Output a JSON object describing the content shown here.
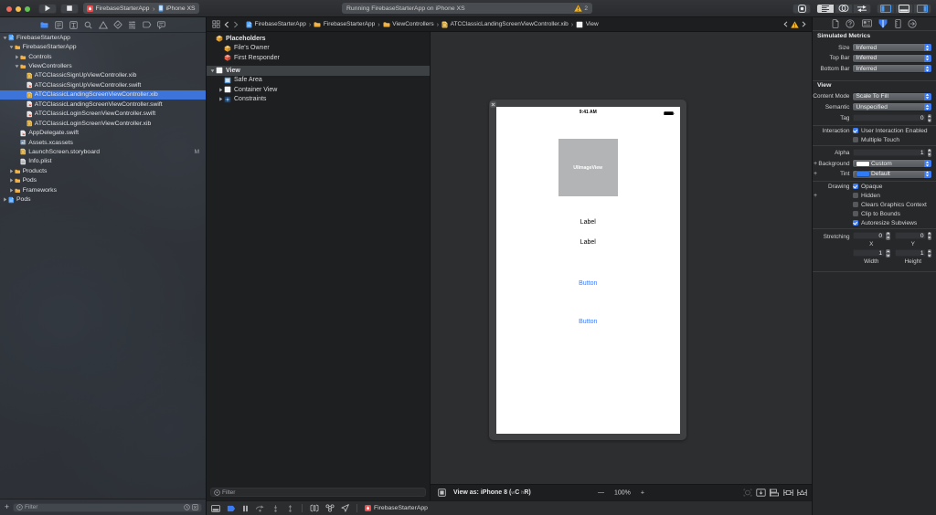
{
  "colors": {
    "accent_blue": "#3b7cf6",
    "selection_blue": "#3c74d9",
    "folder_amber": "#efaa3a",
    "warning_yellow": "#f6b21b",
    "run_red": "#ec5f5f"
  },
  "toolbar": {
    "play_button": "play",
    "stop_button": "stop",
    "scheme": {
      "app_name": "FirebaseStarterApp",
      "separator": "›",
      "device_name": "iPhone XS"
    },
    "status": {
      "message": "Running FirebaseStarterApp on iPhone XS",
      "warning_count": "2"
    }
  },
  "navigator": {
    "tabs": [
      "project",
      "source-control",
      "symbol",
      "find",
      "issue",
      "test",
      "debug",
      "breakpoint",
      "report"
    ],
    "selected_tab": "project",
    "tree": [
      {
        "label": "FirebaseStarterApp",
        "icon": "project",
        "level": 0,
        "disc": "open"
      },
      {
        "label": "FirebaseStarterApp",
        "icon": "folder",
        "level": 1,
        "disc": "open"
      },
      {
        "label": "Controls",
        "icon": "folder",
        "level": 2,
        "disc": "closed"
      },
      {
        "label": "ViewControllers",
        "icon": "folder",
        "level": 2,
        "disc": "open"
      },
      {
        "label": "ATCClassicSignUpViewController.xib",
        "icon": "xib",
        "level": 3
      },
      {
        "label": "ATCClassicSignUpViewController.swift",
        "icon": "swift",
        "level": 3
      },
      {
        "label": "ATCClassicLandingScreenViewController.xib",
        "icon": "xib",
        "level": 3,
        "selected": true
      },
      {
        "label": "ATCClassicLandingScreenViewController.swift",
        "icon": "swift",
        "level": 3
      },
      {
        "label": "ATCClassicLoginScreenViewController.swift",
        "icon": "swift",
        "level": 3
      },
      {
        "label": "ATCClassicLoginScreenViewController.xib",
        "icon": "xib",
        "level": 3
      },
      {
        "label": "AppDelegate.swift",
        "icon": "swift",
        "level": 2
      },
      {
        "label": "Assets.xcassets",
        "icon": "xcassets",
        "level": 2
      },
      {
        "label": "LaunchScreen.storyboard",
        "icon": "storyboard",
        "level": 2,
        "badge": "M"
      },
      {
        "label": "Info.plist",
        "icon": "plist",
        "level": 2
      },
      {
        "label": "Products",
        "icon": "folder",
        "level": 1,
        "disc": "closed"
      },
      {
        "label": "Pods",
        "icon": "folder",
        "level": 1,
        "disc": "closed"
      },
      {
        "label": "Frameworks",
        "icon": "folder",
        "level": 1,
        "disc": "closed"
      },
      {
        "label": "Pods",
        "icon": "project",
        "level": 0,
        "disc": "closed"
      }
    ],
    "filter": {
      "placeholder": "Filter"
    }
  },
  "jumpbar": {
    "crumbs": [
      {
        "label": "FirebaseStarterApp",
        "icon": "project"
      },
      {
        "label": "FirebaseStarterApp",
        "icon": "folder"
      },
      {
        "label": "ViewControllers",
        "icon": "folder"
      },
      {
        "label": "ATCClassicLandingScreenViewController.xib",
        "icon": "xib"
      },
      {
        "label": "View",
        "icon": "view-square"
      }
    ],
    "separator": "›"
  },
  "outline": {
    "rows": [
      {
        "label": "Placeholders",
        "icon": "cube-amber",
        "level": 0,
        "head": true
      },
      {
        "label": "File's Owner",
        "icon": "cube-amber",
        "level": 1
      },
      {
        "label": "First Responder",
        "icon": "cube-red",
        "level": 1
      },
      {
        "label": "View",
        "icon": "view-square",
        "level": 0,
        "head": true,
        "disc": "open",
        "selected": true,
        "gap_before": true
      },
      {
        "label": "Safe Area",
        "icon": "safe-area",
        "level": 1
      },
      {
        "label": "Container View",
        "icon": "view-square",
        "level": 1,
        "disc": "closed"
      },
      {
        "label": "Constraints",
        "icon": "constraints",
        "level": 1,
        "disc": "closed"
      }
    ],
    "filter": {
      "placeholder": "Filter"
    }
  },
  "canvas": {
    "device": {
      "status_time": "9:41 AM",
      "imageview_label": "UIImageView",
      "labels": [
        "Label",
        "Label"
      ],
      "buttons": [
        "Button",
        "Button"
      ]
    },
    "bar": {
      "view_as_prefix": "View as: iPhone 8 (",
      "trait_w": "w",
      "trait_wc": "C",
      "trait_h": "h",
      "trait_hr": "R)",
      "zoom_out": "—",
      "zoom_level": "100%",
      "zoom_in": "+"
    }
  },
  "debugbar": {
    "icons": [
      "toggle-debug-area",
      "breakpoints",
      "pause",
      "step-over",
      "step-into",
      "step-out",
      "view-hierarchy",
      "memory-graph",
      "simulate-location"
    ],
    "process_name": "FirebaseStarterApp"
  },
  "inspector": {
    "tabs": [
      "file",
      "quick-help",
      "identity",
      "attributes",
      "size",
      "connections"
    ],
    "selected_tab": "attributes",
    "sections": [
      {
        "header": "Simulated Metrics",
        "rows": [
          {
            "type": "popup",
            "label": "Size",
            "value": "Inferred"
          },
          {
            "type": "popup",
            "label": "Top Bar",
            "value": "Inferred"
          },
          {
            "type": "popup",
            "label": "Bottom Bar",
            "value": "Inferred"
          }
        ]
      },
      {
        "header": "View",
        "rows": [
          {
            "type": "popup",
            "label": "Content Mode",
            "value": "Scale To Fill"
          },
          {
            "type": "popup",
            "label": "Semantic",
            "value": "Unspecified"
          },
          {
            "type": "field",
            "label": "Tag",
            "value": "0"
          },
          {
            "type": "sep"
          },
          {
            "type": "check",
            "label": "Interaction",
            "value": "User Interaction Enabled",
            "checked": true
          },
          {
            "type": "check",
            "label": "",
            "value": "Multiple Touch",
            "checked": false
          },
          {
            "type": "sep"
          },
          {
            "type": "field",
            "label": "Alpha",
            "value": "1"
          },
          {
            "type": "popup",
            "label": "Background",
            "value": "Custom",
            "swatch": "#ffffff",
            "plus": true
          },
          {
            "type": "popup",
            "label": "Tint",
            "value": "Default",
            "swatch": "#2f7cf6",
            "plus": true
          },
          {
            "type": "sep"
          },
          {
            "type": "check",
            "label": "Drawing",
            "value": "Opaque",
            "checked": true
          },
          {
            "type": "check",
            "label": "",
            "value": "Hidden",
            "checked": false,
            "plus": true
          },
          {
            "type": "check",
            "label": "",
            "value": "Clears Graphics Context",
            "checked": false
          },
          {
            "type": "check",
            "label": "",
            "value": "Clip to Bounds",
            "checked": false
          },
          {
            "type": "check",
            "label": "",
            "value": "Autoresize Subviews",
            "checked": true
          },
          {
            "type": "sep"
          },
          {
            "type": "pair",
            "label": "Stretching",
            "fields": [
              {
                "value": "0",
                "caption": "X"
              },
              {
                "value": "0",
                "caption": "Y"
              }
            ]
          },
          {
            "type": "pair",
            "label": "",
            "fields": [
              {
                "value": "1",
                "caption": "Width"
              },
              {
                "value": "1",
                "caption": "Height"
              }
            ]
          },
          {
            "type": "sep"
          }
        ]
      }
    ]
  }
}
